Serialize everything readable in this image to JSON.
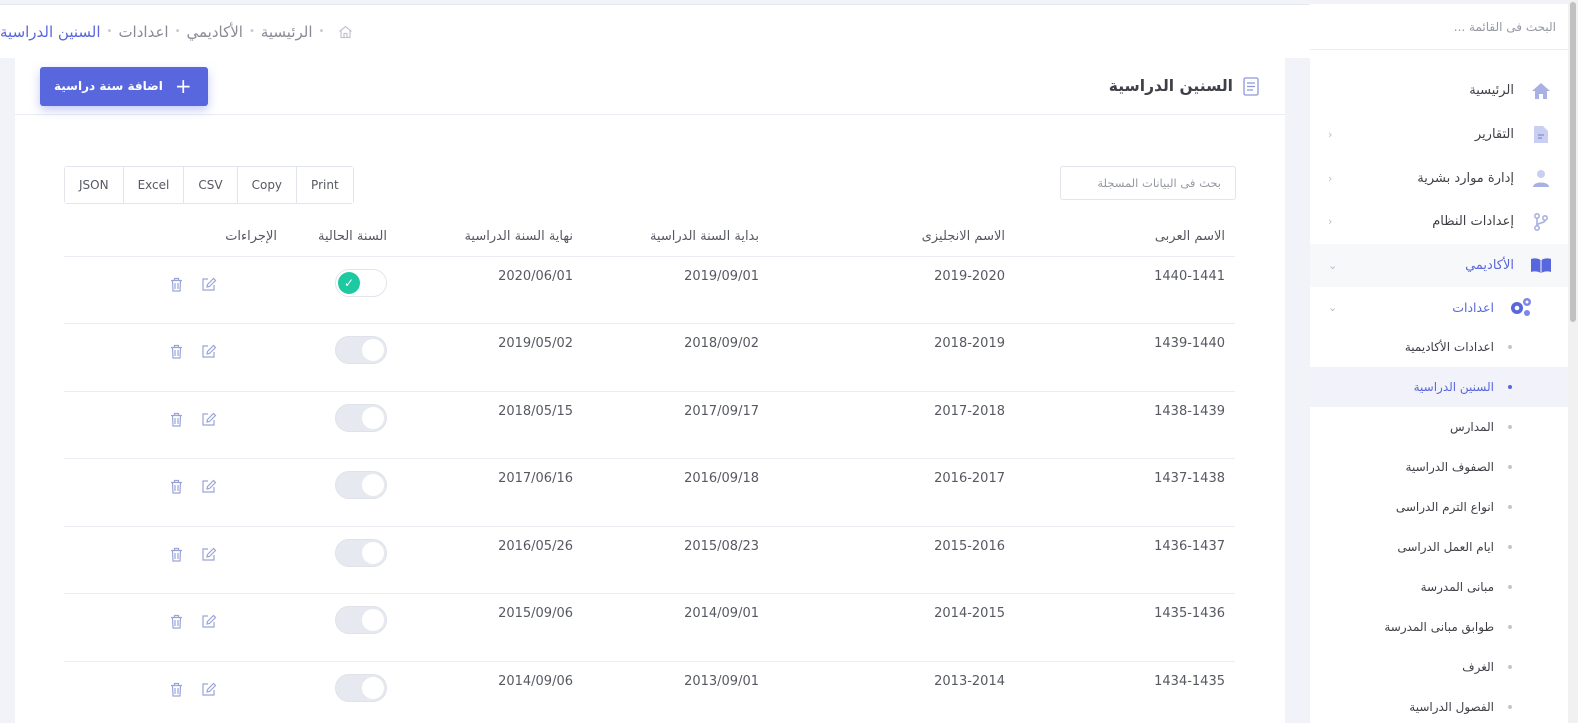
{
  "sidebar": {
    "search_placeholder": "البحث فى القائمة ...",
    "items": [
      {
        "label": "الرئيسية",
        "icon": "home-icon"
      },
      {
        "label": "التقارير",
        "icon": "file-icon"
      },
      {
        "label": "إدارة موارد بشرية",
        "icon": "user-icon"
      },
      {
        "label": "إعدادات النظام",
        "icon": "branch-icon"
      },
      {
        "label": "الأكاديمي",
        "icon": "book-icon"
      }
    ],
    "submenu_head": "اعدادات",
    "subitems": [
      "اعدادات الأكاديمية",
      "السنين الدراسية",
      "المدارس",
      "الصفوف الدراسية",
      "انواع الترم الدراسى",
      "ايام العمل الدراسى",
      "مبانى المدرسة",
      "طوابق مبانى المدرسة",
      "الغرف",
      "الفصول الدراسية"
    ]
  },
  "breadcrumb": {
    "home": "الرئيسية",
    "academic": "الأكاديمي",
    "settings": "اعدادات",
    "current": "السنين الدراسية"
  },
  "card": {
    "title": "السنين الدراسية",
    "add_button": "اضافة سنة دراسية"
  },
  "toolbar": {
    "search_placeholder": "بحث فى البيانات المسجلة",
    "exports": [
      "Print",
      "Copy",
      "CSV",
      "Excel",
      "JSON"
    ]
  },
  "table": {
    "headers": [
      "الاسم العربى",
      "الاسم الانجليزى",
      "بداية السنة الدراسية",
      "نهاية السنة الدراسية",
      "السنة الحالية",
      "الإجراءات"
    ],
    "rows": [
      {
        "ar": "1440-1441",
        "en": "2019-2020",
        "start": "2019/09/01",
        "end": "2020/06/01",
        "current": true
      },
      {
        "ar": "1439-1440",
        "en": "2018-2019",
        "start": "2018/09/02",
        "end": "2019/05/02",
        "current": false
      },
      {
        "ar": "1438-1439",
        "en": "2017-2018",
        "start": "2017/09/17",
        "end": "2018/05/15",
        "current": false
      },
      {
        "ar": "1437-1438",
        "en": "2016-2017",
        "start": "2016/09/18",
        "end": "2017/06/16",
        "current": false
      },
      {
        "ar": "1436-1437",
        "en": "2015-2016",
        "start": "2015/08/23",
        "end": "2016/05/26",
        "current": false
      },
      {
        "ar": "1435-1436",
        "en": "2014-2015",
        "start": "2014/09/01",
        "end": "2015/09/06",
        "current": false
      },
      {
        "ar": "1434-1435",
        "en": "2013-2014",
        "start": "2013/09/01",
        "end": "2014/09/06",
        "current": false
      }
    ]
  },
  "colors": {
    "accent": "#5867dd",
    "success": "#1dc9a0",
    "muted_icon": "#9aa3d8"
  }
}
